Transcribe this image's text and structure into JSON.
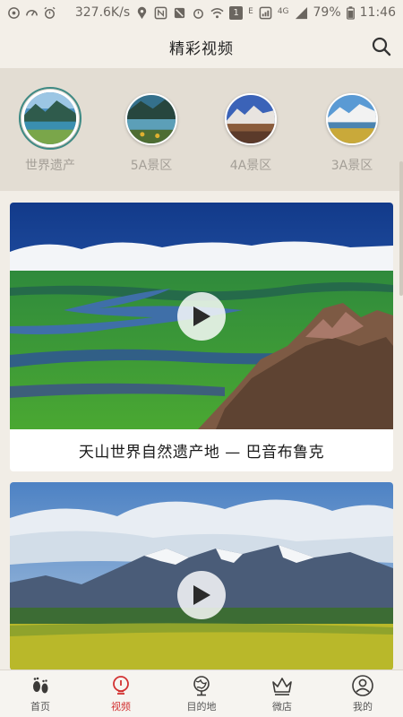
{
  "status_bar": {
    "speed": "327.6K/s",
    "network": "4G",
    "battery": "79%",
    "time": "11:46",
    "badge": "1"
  },
  "header": {
    "title": "精彩视频",
    "search_icon": "search-icon"
  },
  "categories": [
    {
      "label": "世界遗产",
      "active": true
    },
    {
      "label": "5A景区",
      "active": false
    },
    {
      "label": "4A景区",
      "active": false
    },
    {
      "label": "3A景区",
      "active": false
    }
  ],
  "videos": [
    {
      "title": "天山世界自然遗产地 — 巴音布鲁克"
    },
    {
      "title": ""
    }
  ],
  "bottom_nav": [
    {
      "label": "首页",
      "icon": "footprints-icon",
      "active": false
    },
    {
      "label": "视频",
      "icon": "video-bulb-icon",
      "active": true
    },
    {
      "label": "目的地",
      "icon": "globe-icon",
      "active": false
    },
    {
      "label": "微店",
      "icon": "crown-icon",
      "active": false
    },
    {
      "label": "我的",
      "icon": "user-icon",
      "active": false
    }
  ],
  "colors": {
    "accent": "#d23232",
    "active_ring": "#3e8a84",
    "background": "#f1ede6"
  }
}
